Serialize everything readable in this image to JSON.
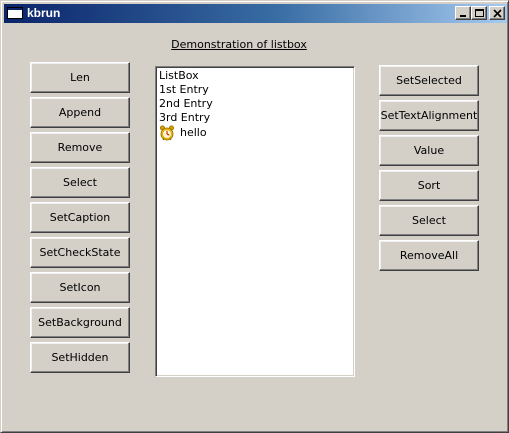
{
  "window": {
    "title": "kbrun"
  },
  "caption": "Demonstration of listbox",
  "left_buttons": [
    "Len",
    "Append",
    "Remove",
    "Select",
    "SetCaption",
    "SetCheckState",
    "SetIcon",
    "SetBackground",
    "SetHidden"
  ],
  "right_buttons": [
    "SetSelected",
    "SetTextAlignment",
    "Value",
    "Sort",
    "Select",
    "RemoveAll"
  ],
  "listbox": {
    "items": [
      "ListBox",
      "1st Entry",
      "2nd Entry",
      "3rd Entry",
      "hello"
    ],
    "icon_item": {
      "index": 4,
      "icon": "clock-icon"
    }
  },
  "colors": {
    "face": "#d4d0c8",
    "titlebar_start": "#0a246a",
    "titlebar_end": "#a6caf0"
  }
}
